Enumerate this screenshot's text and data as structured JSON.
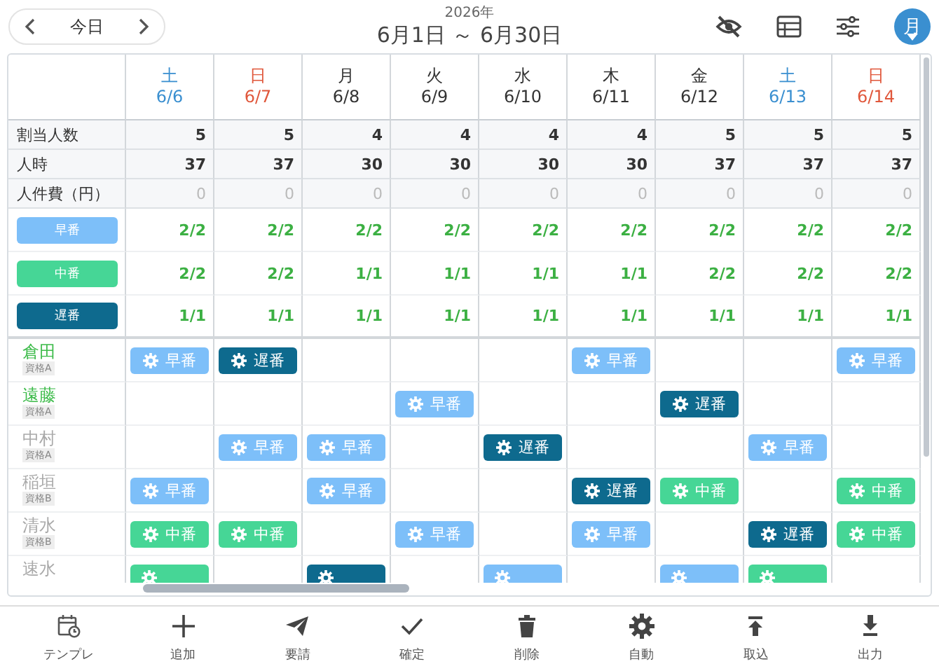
{
  "nav": {
    "today": "今日"
  },
  "period": {
    "year": "2026年",
    "range": "6月1日 ～ 6月30日"
  },
  "view_button": {
    "label": "月"
  },
  "days": [
    {
      "weekday": "土",
      "date": "6/6",
      "kind": "saturday"
    },
    {
      "weekday": "日",
      "date": "6/7",
      "kind": "sunday"
    },
    {
      "weekday": "月",
      "date": "6/8",
      "kind": "weekday"
    },
    {
      "weekday": "火",
      "date": "6/9",
      "kind": "weekday"
    },
    {
      "weekday": "水",
      "date": "6/10",
      "kind": "weekday"
    },
    {
      "weekday": "木",
      "date": "6/11",
      "kind": "weekday"
    },
    {
      "weekday": "金",
      "date": "6/12",
      "kind": "weekday"
    },
    {
      "weekday": "土",
      "date": "6/13",
      "kind": "saturday"
    },
    {
      "weekday": "日",
      "date": "6/14",
      "kind": "sunday"
    }
  ],
  "summary_rows": [
    {
      "label": "割当人数",
      "muted": false,
      "values": [
        "5",
        "5",
        "4",
        "4",
        "4",
        "4",
        "5",
        "5",
        "5"
      ]
    },
    {
      "label": "人時",
      "muted": false,
      "values": [
        "37",
        "37",
        "30",
        "30",
        "30",
        "30",
        "37",
        "37",
        "37"
      ]
    },
    {
      "label": "人件費（円）",
      "muted": true,
      "values": [
        "0",
        "0",
        "0",
        "0",
        "0",
        "0",
        "0",
        "0",
        "0"
      ]
    }
  ],
  "shift_types": [
    {
      "label": "早番",
      "kind": "early",
      "values": [
        "2/2",
        "2/2",
        "2/2",
        "2/2",
        "2/2",
        "2/2",
        "2/2",
        "2/2",
        "2/2"
      ]
    },
    {
      "label": "中番",
      "kind": "middle",
      "values": [
        "2/2",
        "2/2",
        "1/1",
        "1/1",
        "1/1",
        "1/1",
        "2/2",
        "2/2",
        "2/2"
      ]
    },
    {
      "label": "遅番",
      "kind": "late",
      "values": [
        "1/1",
        "1/1",
        "1/1",
        "1/1",
        "1/1",
        "1/1",
        "1/1",
        "1/1",
        "1/1"
      ]
    }
  ],
  "staff": [
    {
      "name": "倉田",
      "qualification": "資格A",
      "color": "#3dbb4a",
      "shifts": [
        {
          "label": "早番",
          "kind": "early"
        },
        {
          "label": "遅番",
          "kind": "late"
        },
        {
          "kind": "empty"
        },
        {
          "kind": "empty"
        },
        {
          "kind": "empty"
        },
        {
          "label": "早番",
          "kind": "early"
        },
        {
          "kind": "empty"
        },
        {
          "kind": "empty"
        },
        {
          "label": "早番",
          "kind": "early"
        }
      ]
    },
    {
      "name": "遠藤",
      "qualification": "資格A",
      "color": "#3dbb4a",
      "shifts": [
        {
          "kind": "empty"
        },
        {
          "kind": "empty"
        },
        {
          "kind": "empty"
        },
        {
          "label": "早番",
          "kind": "early"
        },
        {
          "kind": "empty"
        },
        {
          "kind": "empty"
        },
        {
          "label": "遅番",
          "kind": "late"
        },
        {
          "kind": "empty"
        },
        {
          "kind": "empty"
        }
      ]
    },
    {
      "name": "中村",
      "qualification": "資格A",
      "color": "#a9a9a9",
      "shifts": [
        {
          "kind": "empty"
        },
        {
          "label": "早番",
          "kind": "early"
        },
        {
          "label": "早番",
          "kind": "early"
        },
        {
          "kind": "empty"
        },
        {
          "label": "遅番",
          "kind": "late"
        },
        {
          "kind": "empty"
        },
        {
          "kind": "empty"
        },
        {
          "label": "早番",
          "kind": "early"
        },
        {
          "kind": "empty"
        }
      ]
    },
    {
      "name": "稲垣",
      "qualification": "資格B",
      "color": "#a9a9a9",
      "shifts": [
        {
          "label": "早番",
          "kind": "early"
        },
        {
          "kind": "empty"
        },
        {
          "label": "早番",
          "kind": "early"
        },
        {
          "kind": "empty"
        },
        {
          "kind": "empty"
        },
        {
          "label": "遅番",
          "kind": "late"
        },
        {
          "label": "中番",
          "kind": "middle"
        },
        {
          "kind": "empty"
        },
        {
          "label": "中番",
          "kind": "middle"
        }
      ]
    },
    {
      "name": "清水",
      "qualification": "資格B",
      "color": "#a9a9a9",
      "shifts": [
        {
          "label": "中番",
          "kind": "middle"
        },
        {
          "label": "中番",
          "kind": "middle"
        },
        {
          "kind": "empty"
        },
        {
          "label": "早番",
          "kind": "early"
        },
        {
          "kind": "empty"
        },
        {
          "label": "早番",
          "kind": "early"
        },
        {
          "kind": "empty"
        },
        {
          "label": "遅番",
          "kind": "late"
        },
        {
          "label": "中番",
          "kind": "middle"
        }
      ]
    },
    {
      "name": "速水",
      "color": "#a9a9a9",
      "shifts": [
        {
          "kind": "middle"
        },
        {
          "kind": "empty"
        },
        {
          "kind": "late"
        },
        {
          "kind": "empty"
        },
        {
          "kind": "early"
        },
        {
          "kind": "empty"
        },
        {
          "kind": "early"
        },
        {
          "kind": "middle"
        },
        {
          "kind": "empty"
        }
      ]
    }
  ],
  "toolbar": [
    {
      "label": "テンプレ",
      "kind": "template"
    },
    {
      "label": "追加",
      "kind": "add"
    },
    {
      "label": "要請",
      "kind": "send"
    },
    {
      "label": "確定",
      "kind": "confirm"
    },
    {
      "label": "削除",
      "kind": "delete"
    },
    {
      "label": "自動",
      "kind": "auto"
    },
    {
      "label": "取込",
      "kind": "import"
    },
    {
      "label": "出力",
      "kind": "export"
    }
  ]
}
